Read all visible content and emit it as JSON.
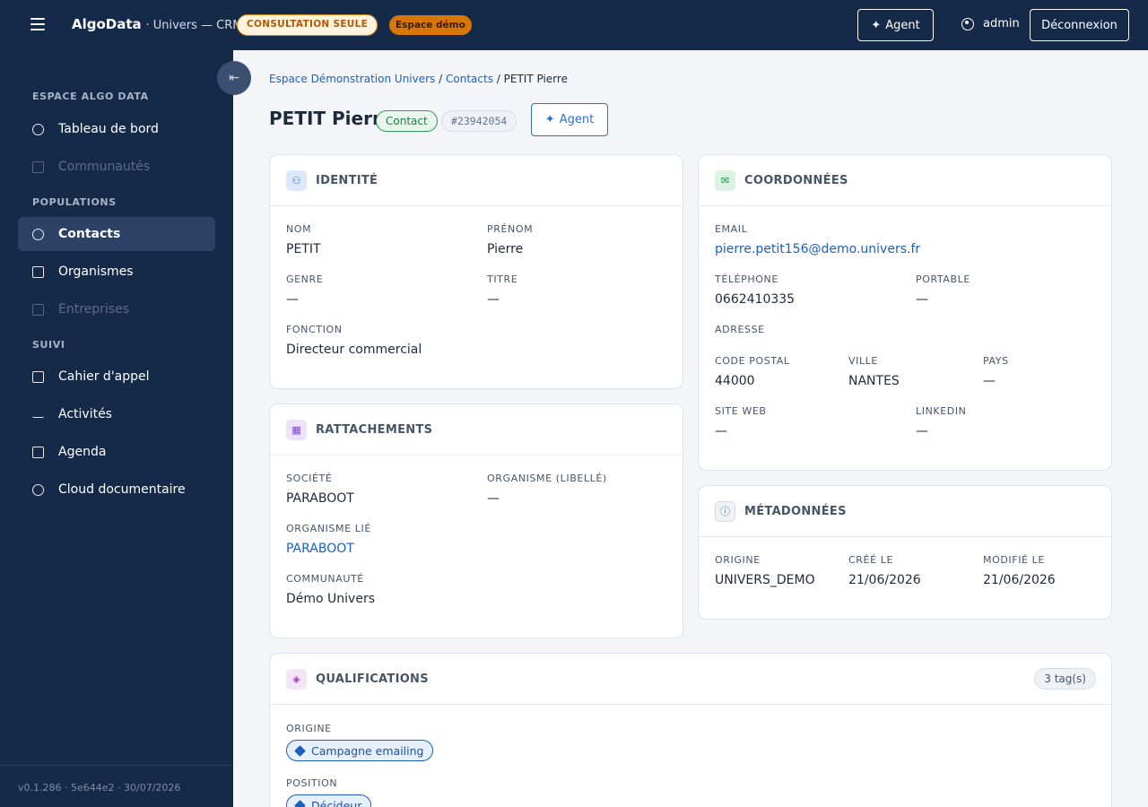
{
  "topbar": {
    "brand_name": "AlgoData",
    "brand_sub": "· Univers — CRM",
    "readonly_badge": "CONSULTATION SEULE",
    "demo_badge": "Espace démo",
    "agent_label": "Agent",
    "user_name": "admin",
    "logout_label": "Déconnexion"
  },
  "sidebar": {
    "sections": [
      {
        "label": "ESPACE ALGO DATA"
      },
      {
        "label": "POPULATIONS"
      },
      {
        "label": "SUIVI"
      }
    ],
    "items": [
      {
        "label": "Tableau de bord",
        "icon": "dashboard-icon"
      },
      {
        "label": "Communautés",
        "icon": "community-icon"
      },
      {
        "label": "Contacts",
        "icon": "users-icon"
      },
      {
        "label": "Organismes",
        "icon": "building-icon"
      },
      {
        "label": "Entreprises",
        "icon": "briefcase-icon"
      },
      {
        "label": "Cahier d'appel",
        "icon": "notebook-icon"
      },
      {
        "label": "Activités",
        "icon": "activity-icon"
      },
      {
        "label": "Agenda",
        "icon": "calendar-icon"
      },
      {
        "label": "Cloud documentaire",
        "icon": "cloud-icon"
      }
    ],
    "version": "v0.1.286 · 5e644e2 · 30/07/2026"
  },
  "breadcrumb": {
    "item1": "Espace Démonstration Univers",
    "sep": "/",
    "item2": "Contacts",
    "item3": "PETIT Pierre"
  },
  "header": {
    "title": "PETIT Pierre",
    "type_badge": "Contact",
    "id_badge": "#23942054",
    "agent_label": "Agent"
  },
  "identite": {
    "title": "IDENTITÉ",
    "nom_label": "NOM",
    "nom": "PETIT",
    "prenom_label": "PRÉNOM",
    "prenom": "Pierre",
    "genre_label": "GENRE",
    "genre": "—",
    "titre_label": "TITRE",
    "titre": "—",
    "fonction_label": "FONCTION",
    "fonction": "Directeur commercial"
  },
  "coordonnees": {
    "title": "COORDONNÉES",
    "email_label": "EMAIL",
    "email": "pierre.petit156@demo.univers.fr",
    "tel_label": "TÉLÉPHONE",
    "tel": "0662410335",
    "portable_label": "PORTABLE",
    "portable": "—",
    "adresse_label": "ADRESSE",
    "cp_label": "CODE POSTAL",
    "cp": "44000",
    "ville_label": "VILLE",
    "ville": "NANTES",
    "pays_label": "PAYS",
    "pays": "—",
    "site_label": "SITE WEB",
    "site": "—",
    "linkedin_label": "LINKEDIN",
    "linkedin": "—"
  },
  "rattachements": {
    "title": "RATTACHEMENTS",
    "societe_label": "SOCIÉTÉ",
    "societe": "PARABOOT",
    "organisme_libelle_label": "ORGANISME (LIBELLÉ)",
    "organisme_libelle": "—",
    "organisme_lie_label": "ORGANISME LIÉ",
    "organisme_lie": "PARABOOT",
    "communaute_label": "COMMUNAUTÉ",
    "communaute": "Démo Univers"
  },
  "metadonnees": {
    "title": "MÉTADONNÉES",
    "origine_label": "ORIGINE",
    "origine": "UNIVERS_DEMO",
    "cree_label": "CRÉÉ LE",
    "cree": "21/06/2026",
    "modifie_label": "MODIFIÉ LE",
    "modifie": "21/06/2026"
  },
  "qualifications": {
    "title": "QUALIFICATIONS",
    "count": "3 tag(s)",
    "origine_label": "ORIGINE",
    "origine_tag": "Campagne emailing",
    "position_label": "POSITION",
    "position_tag": "Décideur"
  }
}
